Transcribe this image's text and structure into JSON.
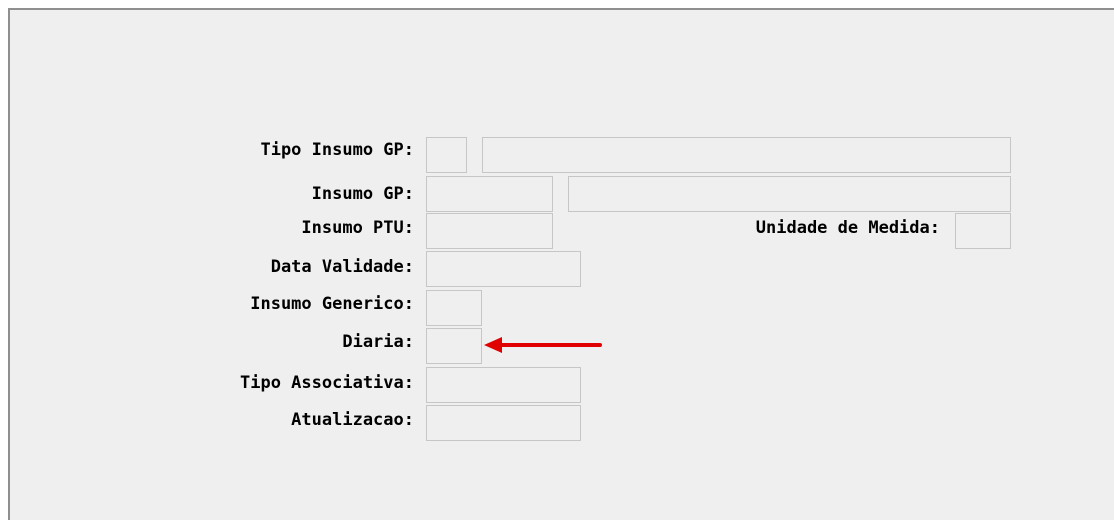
{
  "form": {
    "fields": {
      "tipo_insumo_gp": {
        "label": "Tipo Insumo GP:",
        "code": "",
        "description": ""
      },
      "insumo_gp": {
        "label": "Insumo GP:",
        "code": "",
        "description": ""
      },
      "insumo_ptu": {
        "label": "Insumo PTU:",
        "value": ""
      },
      "unidade_de_medida": {
        "label": "Unidade de Medida:",
        "value": ""
      },
      "data_validade": {
        "label": "Data Validade:",
        "value": ""
      },
      "insumo_generico": {
        "label": "Insumo Generico:",
        "value": ""
      },
      "diaria": {
        "label": "Diaria:",
        "value": ""
      },
      "tipo_associativa": {
        "label": "Tipo Associativa:",
        "value": ""
      },
      "atualizacao": {
        "label": "Atualizacao:",
        "value": ""
      }
    }
  },
  "annotation": {
    "arrow_color": "#e00000",
    "points_to": "diaria-field"
  },
  "colors": {
    "background": "#efefef",
    "field_border": "#c6c6c6",
    "frame_border": "#8f8f8f"
  }
}
